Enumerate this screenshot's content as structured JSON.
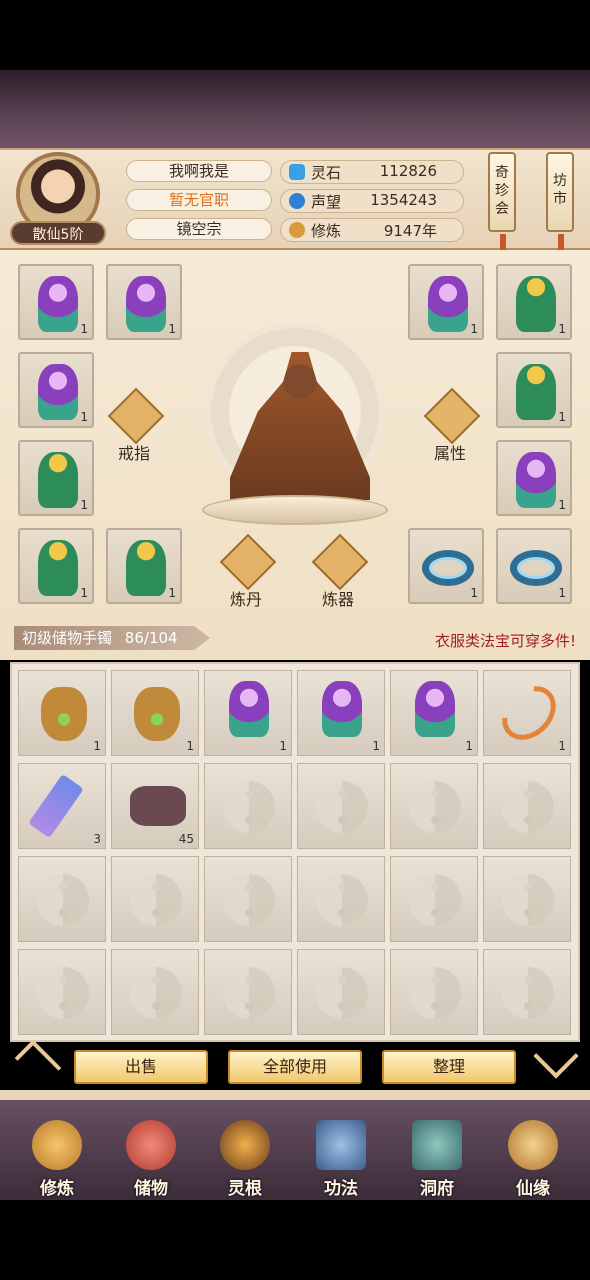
{
  "header": {
    "rank": "散仙5阶",
    "name": "我啊我是",
    "office": "暂无官职",
    "sect": "镜空宗",
    "resources": [
      {
        "icon": "spirit-stone-icon",
        "label": "灵石",
        "value": "112826",
        "color": "#3aa0e6"
      },
      {
        "icon": "reputation-icon",
        "label": "声望",
        "value": "1354243",
        "color": "#2f7fd3"
      },
      {
        "icon": "cultivation-icon",
        "label": "修炼",
        "value": "9147年",
        "color": "#d89a3a"
      }
    ],
    "scroll_buttons": [
      {
        "label": "奇\n珍\n会"
      },
      {
        "label": "坊\n市"
      }
    ]
  },
  "equipment": {
    "left_slots": [
      {
        "item": "robe-purple",
        "count": "1"
      },
      {
        "item": "robe-purple",
        "count": "1"
      },
      {
        "item": "robe-purple",
        "count": "1"
      },
      {
        "item": "robe-green",
        "count": "1"
      },
      {
        "item": "robe-green",
        "count": "1"
      },
      {
        "item": "robe-green",
        "count": "1"
      }
    ],
    "right_slots": [
      {
        "item": "robe-purple",
        "count": "1"
      },
      {
        "item": "robe-green",
        "count": "1"
      },
      {
        "item": "robe-green-orb",
        "count": "1"
      },
      {
        "item": "robe-purple",
        "count": "1"
      },
      {
        "item": "ring-blue",
        "count": "1"
      },
      {
        "item": "ring-blue",
        "count": "1"
      }
    ],
    "actions": {
      "ring": "戒指",
      "attribute": "属性",
      "alchemy": "炼丹",
      "refine": "炼器"
    }
  },
  "storage": {
    "title": "初级储物手镯",
    "capacity": "86/104",
    "note": "衣服类法宝可穿多件!",
    "items": [
      {
        "item": "bag",
        "count": "1"
      },
      {
        "item": "bag",
        "count": "1"
      },
      {
        "item": "robe-purple",
        "count": "1"
      },
      {
        "item": "robe-purple",
        "count": "1"
      },
      {
        "item": "robe-purple",
        "count": "1"
      },
      {
        "item": "bow",
        "count": "1"
      },
      {
        "item": "scroll",
        "count": "3"
      },
      {
        "item": "stone",
        "count": "45"
      }
    ]
  },
  "buttons": {
    "sell": "出售",
    "use_all": "全部使用",
    "sort": "整理"
  },
  "nav": [
    {
      "label": "修炼",
      "icon": "cultivate-icon"
    },
    {
      "label": "储物",
      "icon": "storage-bag-icon"
    },
    {
      "label": "灵根",
      "icon": "spirit-root-icon"
    },
    {
      "label": "功法",
      "icon": "technique-icon"
    },
    {
      "label": "洞府",
      "icon": "cave-dwelling-icon"
    },
    {
      "label": "仙缘",
      "icon": "immortal-fate-icon"
    }
  ]
}
